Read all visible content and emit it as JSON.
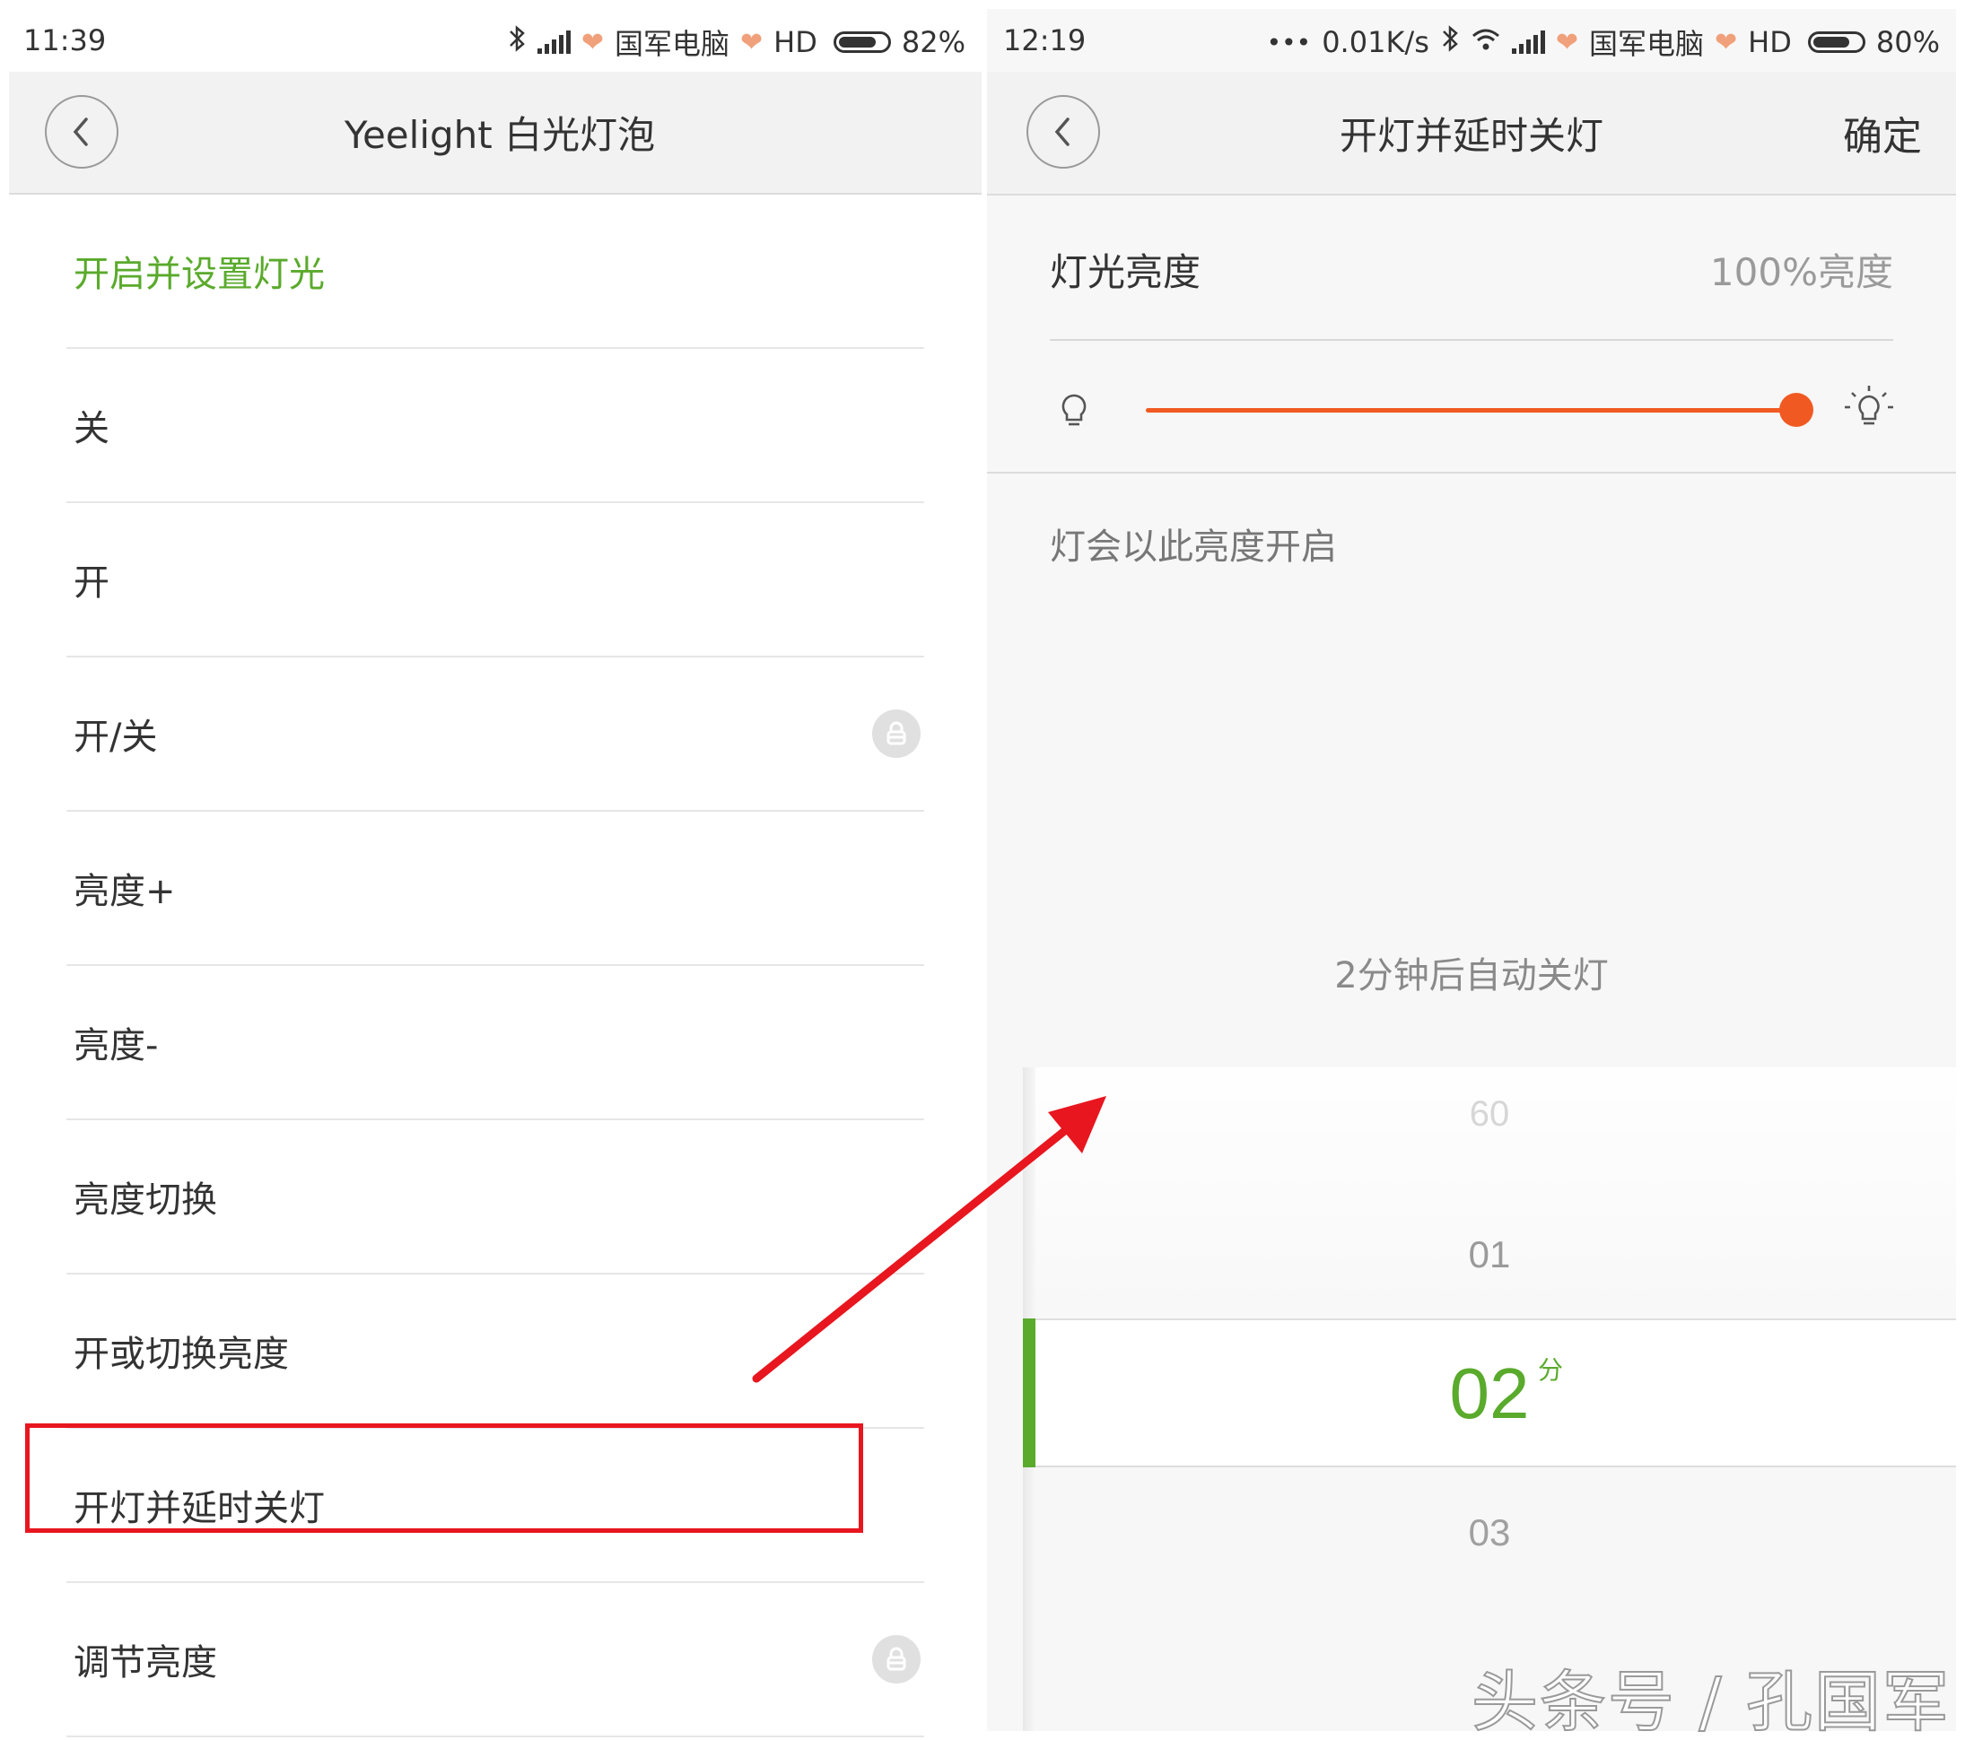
{
  "left": {
    "status": {
      "time": "11:39",
      "carrier": "国军电脑",
      "network": "HD",
      "battery": "82%",
      "battery_level": 0.82
    },
    "header": {
      "title": "Yeelight 白光灯泡"
    },
    "section_title": "开启并设置灯光",
    "items": [
      {
        "label": "关",
        "locked": false
      },
      {
        "label": "开",
        "locked": false
      },
      {
        "label": "开/关",
        "locked": true
      },
      {
        "label": "亮度+",
        "locked": false
      },
      {
        "label": "亮度-",
        "locked": false
      },
      {
        "label": "亮度切换",
        "locked": false
      },
      {
        "label": "开或切换亮度",
        "locked": false
      },
      {
        "label": "开灯并延时关灯",
        "locked": false,
        "highlighted": true
      },
      {
        "label": "调节亮度",
        "locked": true
      }
    ]
  },
  "right": {
    "status": {
      "time": "12:19",
      "dots": "•••",
      "speed": "0.01K/s",
      "carrier": "国军电脑",
      "network": "HD",
      "battery": "80%",
      "battery_level": 0.8
    },
    "header": {
      "title": "开灯并延时关灯",
      "confirm": "确定"
    },
    "brightness": {
      "label": "灯光亮度",
      "value_text": "100%亮度",
      "level": 1.0
    },
    "hint": "灯会以此亮度开启",
    "timer_caption": "2分钟后自动关灯",
    "picker": {
      "above2": "60",
      "above1": "01",
      "selected": "02",
      "unit": "分",
      "below1": "03"
    }
  },
  "watermark": "头条号 / 孔国军",
  "colors": {
    "accent_green": "#5aaa2c",
    "slider_orange": "#f05a22",
    "highlight_red": "#e8161f"
  }
}
